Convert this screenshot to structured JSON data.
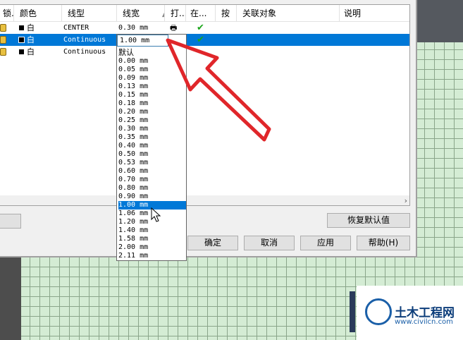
{
  "columns": {
    "lock": "锁...",
    "color": "颜色",
    "linetype": "线型",
    "lineweight": "线宽",
    "plot": "打...",
    "on": "在...",
    "sort": "按",
    "related": "关联对象",
    "desc": "说明"
  },
  "rows": [
    {
      "color": "白",
      "linetype": "CENTER",
      "lineweight": "0.30 mm"
    },
    {
      "color": "白",
      "linetype": "Continuous",
      "lineweight": "1.00 mm"
    },
    {
      "color": "白",
      "linetype": "Continuous",
      "lineweight": ""
    }
  ],
  "combo_value": "1.00 mm",
  "options": [
    "默认",
    "0.00 mm",
    "0.05 mm",
    "0.09 mm",
    "0.13 mm",
    "0.15 mm",
    "0.18 mm",
    "0.20 mm",
    "0.25 mm",
    "0.30 mm",
    "0.35 mm",
    "0.40 mm",
    "0.50 mm",
    "0.53 mm",
    "0.60 mm",
    "0.70 mm",
    "0.80 mm",
    "0.90 mm",
    "1.00 mm",
    "1.06 mm",
    "1.20 mm",
    "1.40 mm",
    "1.58 mm",
    "2.00 mm",
    "2.11 mm"
  ],
  "selected_option": "1.00 mm",
  "buttons": {
    "restore": "恢复默认值",
    "ok": "确定",
    "cancel": "取消",
    "apply": "应用",
    "help": "帮助(H)"
  },
  "watermark": {
    "title": "土木工程网",
    "url": "www.civilcn.com"
  },
  "colors": {
    "selection": "#0078d7",
    "arrow": "#e0262a",
    "grid_bg": "#d4ecd4"
  }
}
